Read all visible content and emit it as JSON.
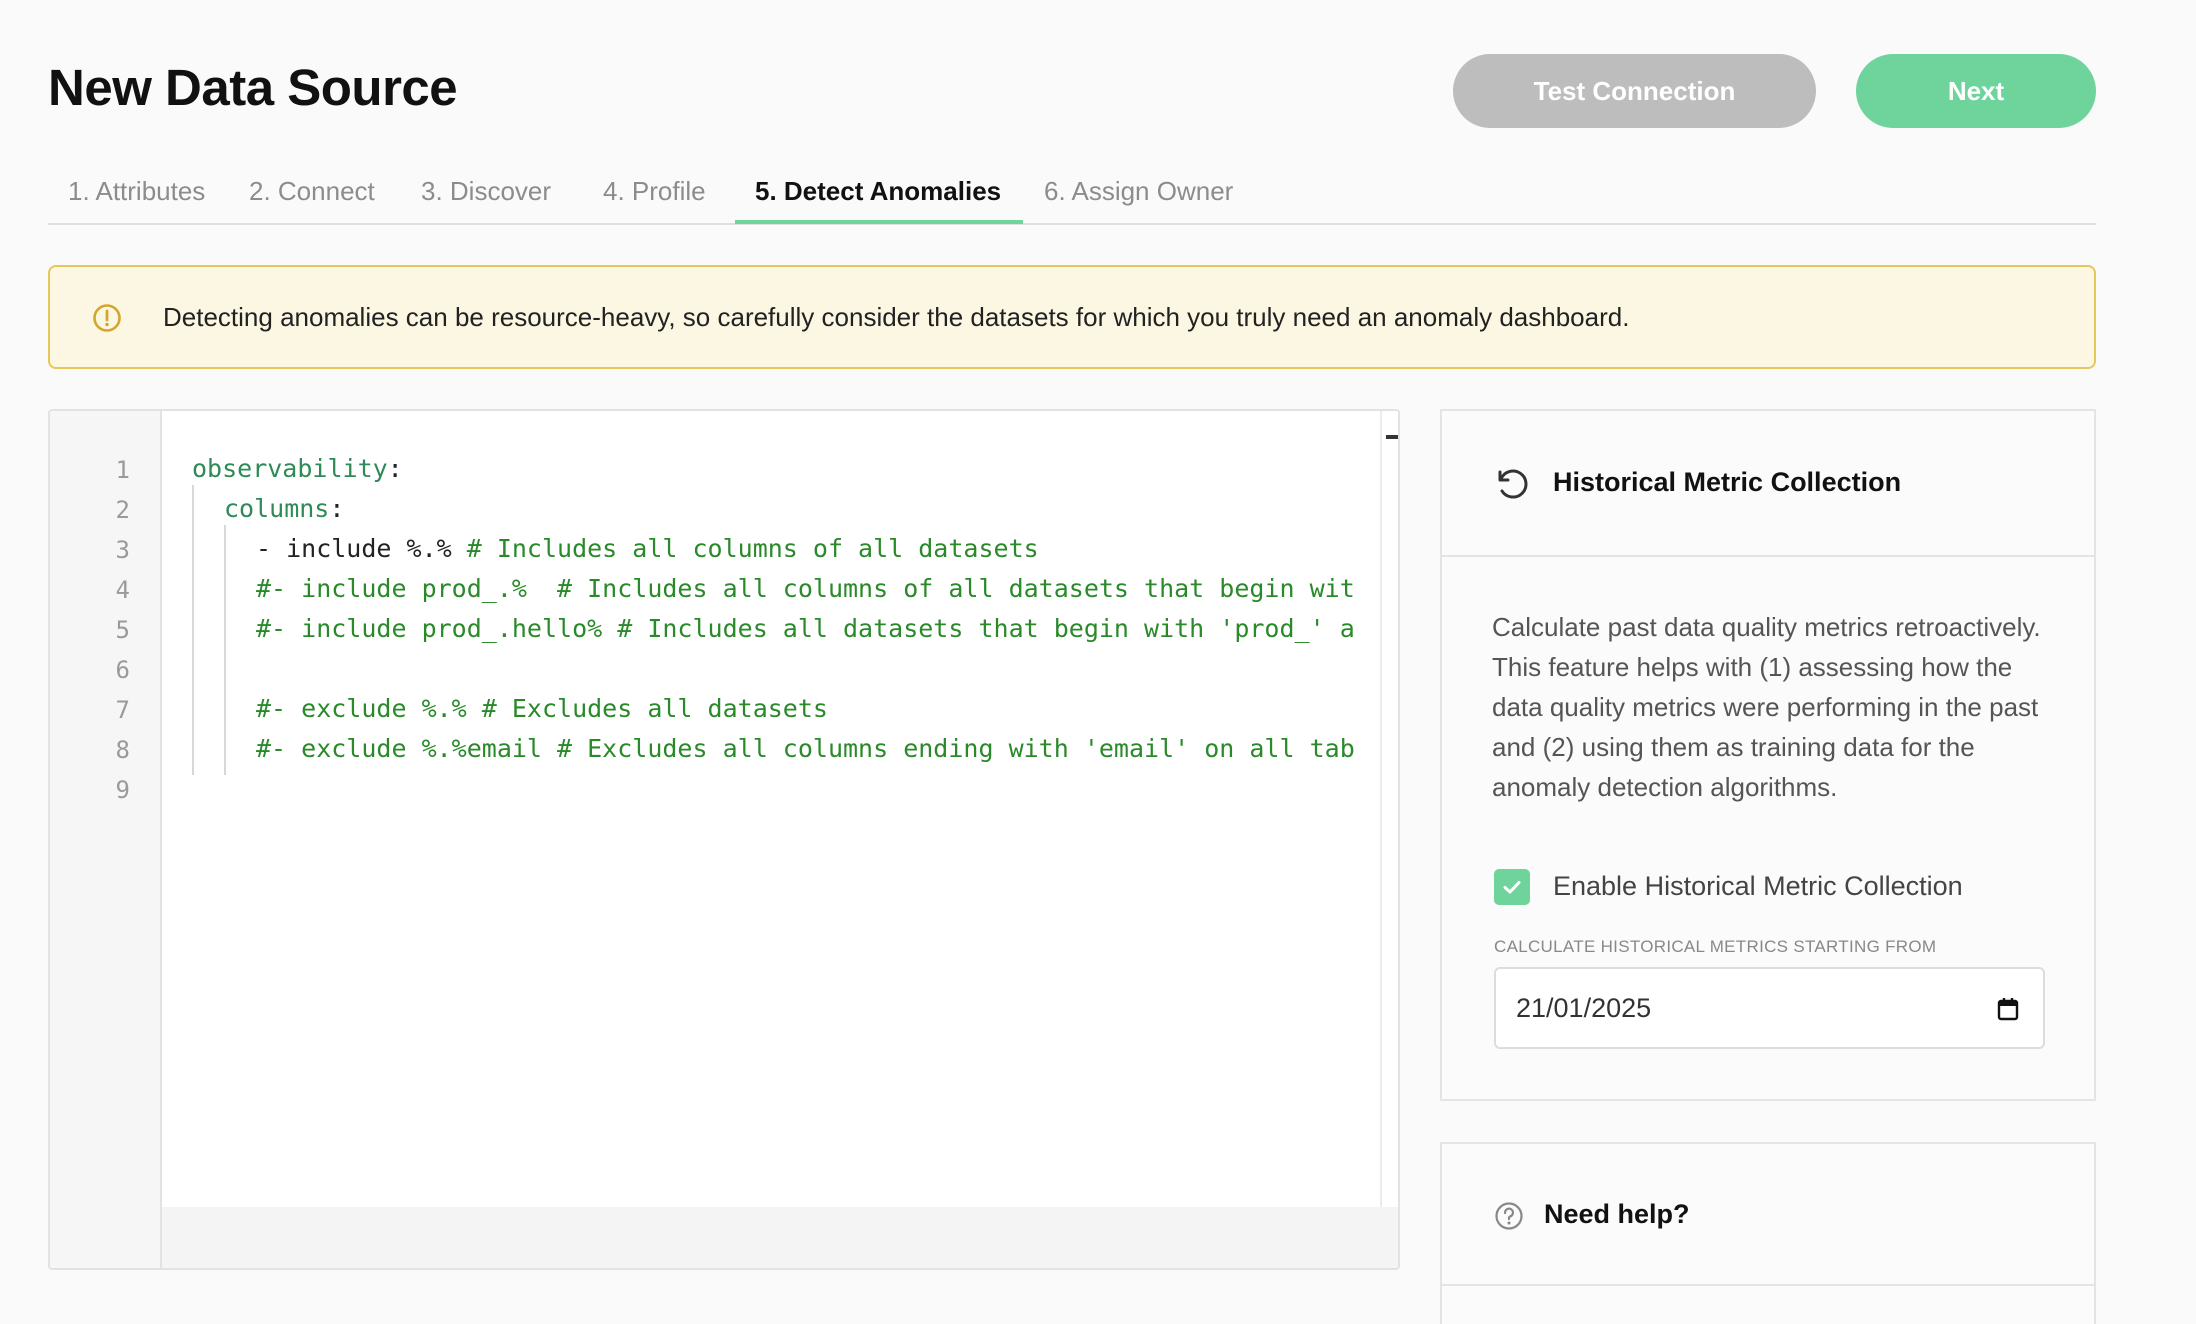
{
  "page": {
    "title": "New Data Source"
  },
  "actions": {
    "test_connection": "Test Connection",
    "next": "Next"
  },
  "tabs": [
    {
      "label": "1. Attributes"
    },
    {
      "label": "2. Connect"
    },
    {
      "label": "3. Discover"
    },
    {
      "label": "4. Profile"
    },
    {
      "label": "5. Detect Anomalies",
      "active": true
    },
    {
      "label": "6. Assign Owner"
    }
  ],
  "alert": {
    "icon": "warning-circle-icon",
    "text": "Detecting anomalies can be resource-heavy, so carefully consider the datasets for which you truly need an anomaly dashboard."
  },
  "editor": {
    "lines": [
      {
        "n": "1",
        "key": "observability",
        "rest": ":"
      },
      {
        "n": "2",
        "key": "columns",
        "rest": ":"
      },
      {
        "n": "3",
        "plain": "- include %.% ",
        "comment": "# Includes all columns of all datasets"
      },
      {
        "n": "4",
        "comment": "#- include prod_.%  # Includes all columns of all datasets that begin wit"
      },
      {
        "n": "5",
        "comment": "#- include prod_.hello% # Includes all datasets that begin with 'prod_' a"
      },
      {
        "n": "6"
      },
      {
        "n": "7",
        "comment": "#- exclude %.% # Excludes all datasets"
      },
      {
        "n": "8",
        "comment": "#- exclude %.%email # Excludes all columns ending with 'email' on all tab"
      },
      {
        "n": "9"
      }
    ]
  },
  "historical": {
    "icon": "history-icon",
    "title": "Historical Metric Collection",
    "description": "Calculate past data quality metrics retroactively. This feature helps with (1) assessing how the data quality metrics were performing in the past and (2) using them as training data for the anomaly detection algorithms.",
    "checkbox_label": "Enable Historical Metric Collection",
    "checkbox_checked": true,
    "date_label": "Calculate historical metrics starting from",
    "date_value": "21/01/2025"
  },
  "help": {
    "icon": "question-circle-icon",
    "title": "Need help?"
  },
  "colors": {
    "accent": "#6fd49c",
    "disabled_button": "#bdbdbd",
    "warning_border": "#e8c65a",
    "warning_bg": "#fcf7e3"
  }
}
